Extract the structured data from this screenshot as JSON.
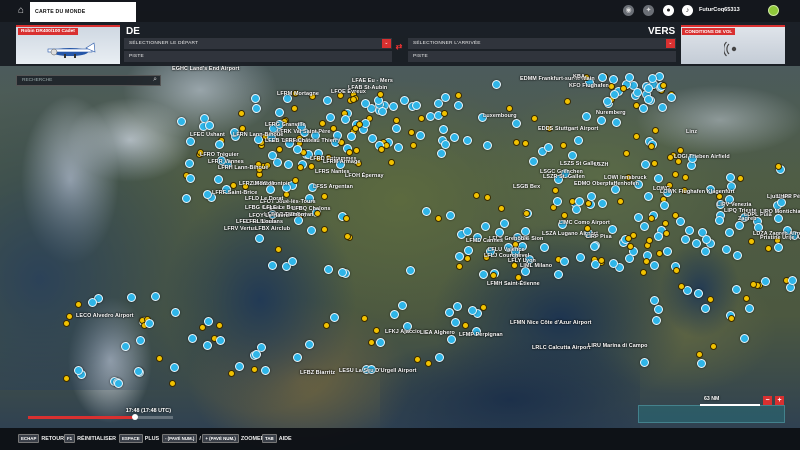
{
  "topbar": {
    "world_map_label": "CARTE DU MONDE",
    "user_name": "FuturCoq65313",
    "icons": [
      "notification-icon",
      "activity-icon",
      "profile-icon",
      "bell-icon"
    ],
    "status_color": "#8fc83a"
  },
  "flight": {
    "aircraft": "Robin DR400/100 Cadet",
    "from_label": "DE",
    "to_label": "VERS",
    "departure_placeholder": "SÉLECTIONNER LE DÉPART",
    "arrival_placeholder": "SÉLECTIONNER L'ARRIVÉE",
    "runway_from": "PISTE",
    "runway_to": "PISTE",
    "conditions_label": "CONDITIONS DE VOL"
  },
  "search": {
    "placeholder": "RECHERCHE"
  },
  "time": {
    "label": "17:48 (17:48 UTC)",
    "progress": 0.74
  },
  "map_scale": {
    "label": "63 NM"
  },
  "hints": [
    {
      "keys": [
        "ECHAP"
      ],
      "label": "RETOUR"
    },
    {
      "keys": [
        "F1"
      ],
      "label": "RÉINITIALISER"
    },
    {
      "keys": [
        "ESPACE"
      ],
      "label": "PLUS"
    },
    {
      "keys": [
        "- (PAVÉ NUM.)",
        "+ (PAVÉ NUM.)"
      ],
      "label": "ZOOMER"
    },
    {
      "keys": [
        "TAB"
      ],
      "label": "AIDE"
    }
  ],
  "airports": [
    "EGHC Land's End Airport",
    "LFAE Eu - Mers",
    "LFAB St-Aubin",
    "LFRM Mortagne",
    "LFOE Évreux",
    "LFRG Granville",
    "LFRK Val Saint Père",
    "LFEC Ushant",
    "LFRN Lann-Bihoué",
    "LFEB Trélissac",
    "LFRF Château Thierry",
    "LFRO Tréguier",
    "LFRR Vannes",
    "LFRH Lann-Bihoué",
    "LFRD Entrammes",
    "LFRM Armage",
    "LFRD Montoir",
    "LFRZ Montoir",
    "LFOH Épernay",
    "LFRS Nantes",
    "LFOT Joué-lès-Tours",
    "LFRF Saint-Brice",
    "LFSS Argentan",
    "LFBG Cognac",
    "LFLE Le Bourg",
    "LFBQ Chalons",
    "LFBY Cognac",
    "LFEZ Royan",
    "LFEC Le Blanc",
    "LFRL Loulans",
    "LFRV Vertus",
    "LFBX Airclub",
    "LFLD Le Dorat",
    "LFOO Talmont",
    "LFOY Le Havre",
    "EDMM Frankfurt-sur-le-Main",
    "KBA",
    "KFO Flughafen",
    "Nuremberg",
    "Luxembourg",
    "EDDS Stuttgart Airport",
    "Linz",
    "LOGI Trieben Airfield",
    "LSZH",
    "LOWG",
    "LOWI Innsbruck",
    "LOWK Flughafen Klagenfurt",
    "LSZA Lugano Airport",
    "LSGG Sion",
    "LSGC Grenchen",
    "LSZS St Gallen",
    "LSGB Bex",
    "EDMO Oberpfaffenhofen",
    "LSZR St. Gallen",
    "LFLS Grenoble",
    "LFLU Valence",
    "LIMC Como Airport",
    "LIML Milano",
    "LIPV Venezia",
    "LIPQ Trieste",
    "LDPL Pula",
    "LIPO Montichiari Airport",
    "Ljubljana",
    "Zagreb",
    "LDZA Zagreb Airport",
    "LHPP Pécs",
    "Pristine Urije Airport",
    "LFMN Nice Côte d'Azur Airport",
    "LRLC Calcutta Airport",
    "LFLJ Courchevel",
    "LFLY Lyon",
    "LFMD Cannes",
    "LFMH Saint-Étienne",
    "LIRU Marina di Campo",
    "LECO Alvedro Airport",
    "LESU La Seu D'Urgell Airport",
    "LFBZ Biarritz",
    "LFKJ Ajaccio",
    "LFMP Perpignan",
    "LIRP Pisa",
    "LIEA Alghero"
  ]
}
